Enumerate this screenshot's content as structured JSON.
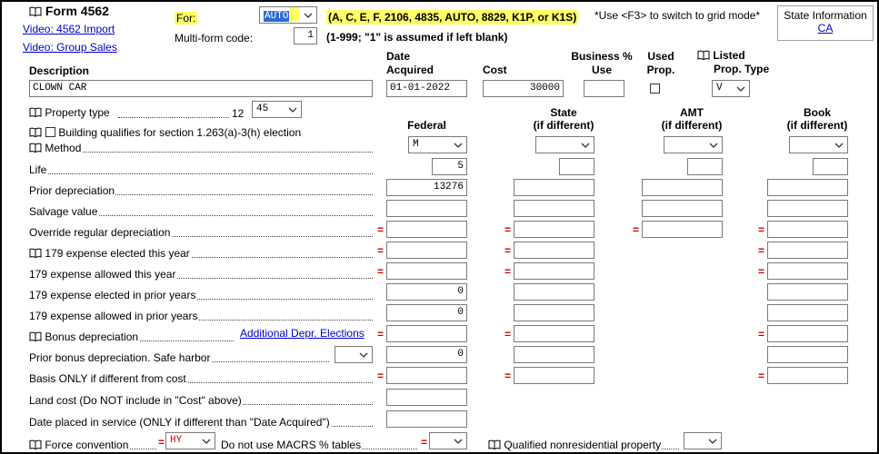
{
  "header": {
    "form_title": "Form 4562",
    "link_import": "Video: 4562 Import",
    "link_group": "Video: Group Sales",
    "for_label": "For:",
    "for_value": "AUTO",
    "for_hint": "(A, C, E, F, 2106, 4835, AUTO, 8829, K1P, or K1S)",
    "grid_hint": "*Use <F3> to switch to grid mode*",
    "state_info_label": "State Information",
    "state_info_link": "CA",
    "multiform_label": "Multi-form code:",
    "multiform_value": "1",
    "multiform_hint": "(1-999; \"1\" is assumed if left blank)"
  },
  "asset": {
    "description_label": "Description",
    "description_value": "CLOWN CAR",
    "date_label_1": "Date",
    "date_label_2": "Acquired",
    "date_value": "01-01-2022",
    "cost_label": "Cost",
    "cost_value": "30000",
    "business_label_1": "Business %",
    "business_label_2": "Use",
    "business_value": "",
    "used_label_1": "Used",
    "used_label_2": "Prop.",
    "listed_label_1": "Listed",
    "listed_label_2": "Prop. Type",
    "listed_value": "V"
  },
  "property_type": {
    "label": "Property type",
    "suffix": "12",
    "value": "45"
  },
  "building_label": "Building qualifies for section 1.263(a)-3(h) election",
  "columns": {
    "federal": "Federal",
    "state_1": "State",
    "state_2": "(if different)",
    "amt_1": "AMT",
    "amt_2": "(if different)",
    "book_1": "Book",
    "book_2": "(if different)"
  },
  "rows": {
    "method": "Method",
    "method_federal": "M",
    "life": "Life",
    "life_federal": "5",
    "prior_depr": "Prior depreciation",
    "prior_depr_federal": "13276",
    "salvage": "Salvage value",
    "override": "Override regular depreciation",
    "elected_179": "179 expense elected this year",
    "allowed_179": "179 expense allowed this year",
    "elected_prior_179": "179 expense elected in prior years",
    "elected_prior_179_federal": "0",
    "allowed_prior_179": "179 expense allowed in prior years",
    "allowed_prior_179_federal": "0",
    "bonus": "Bonus depreciation",
    "bonus_link": "Additional Depr. Elections",
    "prior_bonus": "Prior bonus depreciation. Safe harbor",
    "prior_bonus_federal": "0",
    "basis_only": "Basis ONLY if different from cost",
    "land_cost": "Land cost (Do NOT include in \"Cost\" above)",
    "date_placed": "Date placed in service (ONLY if different than \"Date Acquired\")"
  },
  "footer": {
    "force_label": "Force convention",
    "force_value": "HY",
    "macrs_label": "Do not use MACRS % tables",
    "qualified_label": "Qualified nonresidential property"
  },
  "colors": {
    "equals_red": "#d00000",
    "for_hint_bg": "#ffff66",
    "link_blue": "#0000cc"
  }
}
